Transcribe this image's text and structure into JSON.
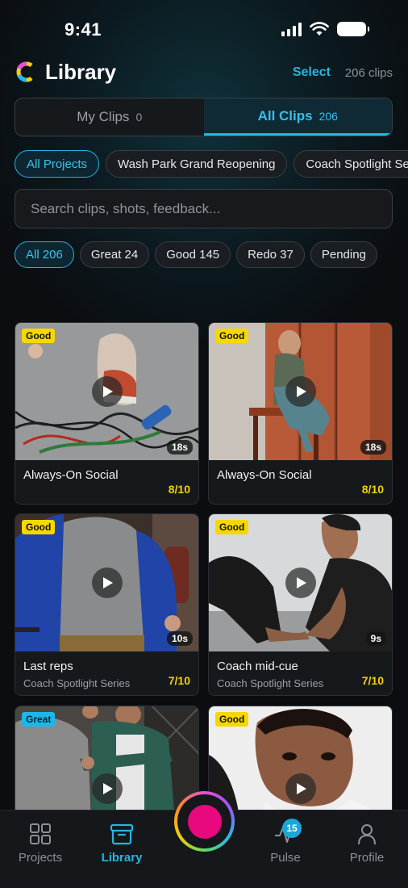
{
  "status_bar": {
    "time": "9:41"
  },
  "header": {
    "title": "Library",
    "select_label": "Select",
    "clip_count": "206 clips"
  },
  "segments": [
    {
      "label": "My Clips",
      "count": "0"
    },
    {
      "label": "All Clips",
      "count": "206"
    }
  ],
  "projects": [
    "All Projects",
    "Wash Park Grand Reopening",
    "Coach Spotlight Series"
  ],
  "search": {
    "placeholder": "Search clips, shots, feedback..."
  },
  "filters": [
    "All 206",
    "Great 24",
    "Good 145",
    "Redo 37",
    "Pending"
  ],
  "clips": [
    {
      "badge": "Good",
      "duration": "18s",
      "title": "Always-On Social",
      "subtitle": "",
      "score": "8/10"
    },
    {
      "badge": "Good",
      "duration": "18s",
      "title": "Always-On Social",
      "subtitle": "",
      "score": "8/10"
    },
    {
      "badge": "Good",
      "duration": "10s",
      "title": "Last reps",
      "subtitle": "Coach Spotlight Series",
      "score": "7/10"
    },
    {
      "badge": "Good",
      "duration": "9s",
      "title": "Coach mid-cue",
      "subtitle": "Coach Spotlight Series",
      "score": "7/10"
    },
    {
      "badge": "Great",
      "duration": "",
      "title": "",
      "subtitle": "",
      "score": ""
    },
    {
      "badge": "Good",
      "duration": "",
      "title": "",
      "subtitle": "",
      "score": ""
    }
  ],
  "tabbar": {
    "projects": "Projects",
    "library": "Library",
    "pulse": "Pulse",
    "pulse_badge": "15",
    "profile": "Profile"
  },
  "colors": {
    "accent": "#27b4e0",
    "good": "#f5d800",
    "great": "#1ab8ea",
    "record": "#e8097e",
    "score": "#f5d000"
  }
}
